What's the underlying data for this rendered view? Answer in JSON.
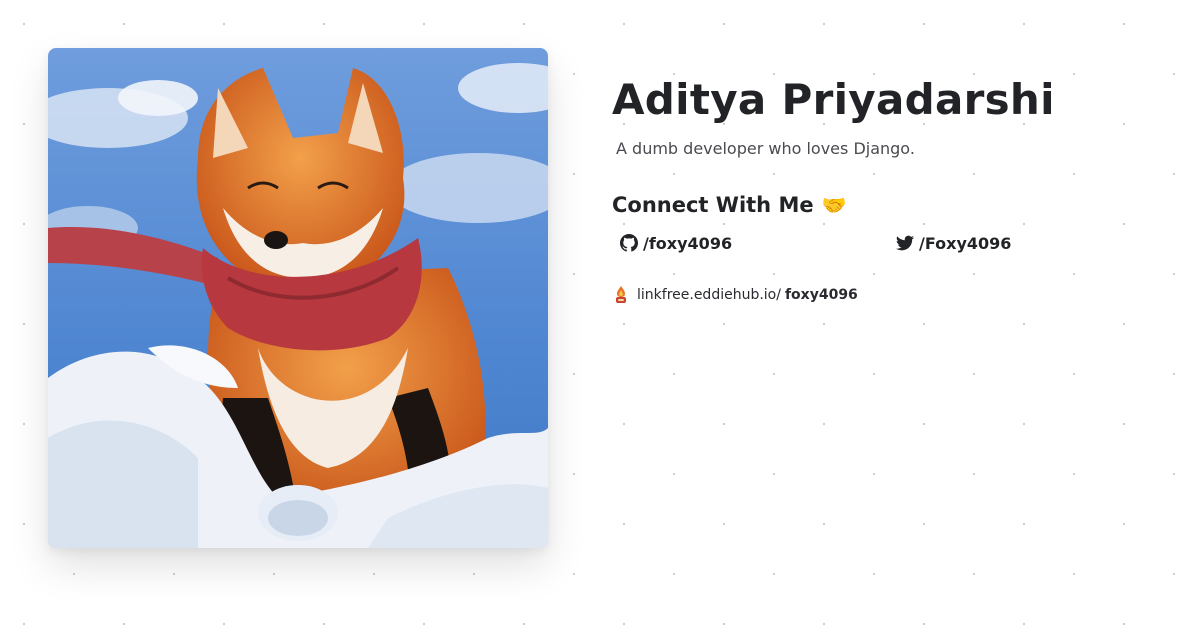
{
  "profile": {
    "name": "Aditya Priyadarshi",
    "bio": "A dumb developer who loves Django.",
    "image_alt": "fox-in-snow-painting"
  },
  "connect": {
    "heading": "Connect With Me",
    "emoji": "🤝"
  },
  "socials": {
    "github": {
      "label": "/foxy4096",
      "icon": "github-icon"
    },
    "twitter": {
      "label": "/Foxy4096",
      "icon": "twitter-icon"
    }
  },
  "linkfree": {
    "domain": "linkfree.eddiehub.io/",
    "username": "foxy4096",
    "icon": "linkfree-logo-icon"
  },
  "colors": {
    "text": "#222327",
    "muted": "#4a4a50",
    "sky": "#5b8fd6",
    "fox": "#e07a2a",
    "scarf": "#b8383f",
    "snow": "#eef2f8"
  }
}
